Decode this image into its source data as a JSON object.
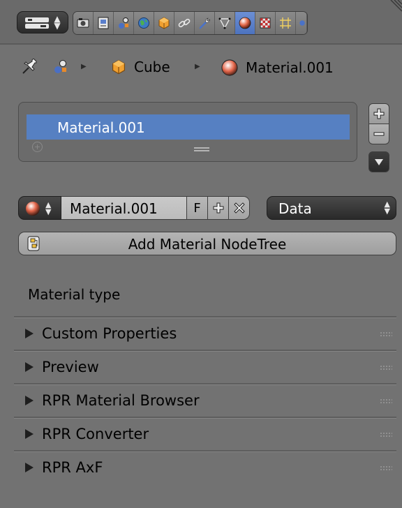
{
  "tabs": [
    {
      "icon": "render-camera-icon",
      "active": false
    },
    {
      "icon": "render-layers-icon",
      "active": false
    },
    {
      "icon": "scene-icon",
      "active": false
    },
    {
      "icon": "world-icon",
      "active": false
    },
    {
      "icon": "object-icon",
      "active": false
    },
    {
      "icon": "constraints-icon",
      "active": false
    },
    {
      "icon": "modifiers-wrench-icon",
      "active": false
    },
    {
      "icon": "object-data-mesh-icon",
      "active": false
    },
    {
      "icon": "material-icon",
      "active": true
    },
    {
      "icon": "texture-icon",
      "active": false
    },
    {
      "icon": "particles-icon",
      "active": false
    },
    {
      "icon": "physics-icon",
      "active": false
    }
  ],
  "breadcrumb": {
    "object": "Cube",
    "material": "Material.001"
  },
  "slots": {
    "items": [
      "Material.001"
    ],
    "selected": 0
  },
  "material_row": {
    "name": "Material.001",
    "fake_user": "F",
    "link_dropdown": "Data"
  },
  "nodetree_button": "Add Material NodeTree",
  "material_type_label": "Material type",
  "panels": [
    "Custom Properties",
    "Preview",
    "RPR Material Browser",
    "RPR Converter",
    "RPR AxF"
  ],
  "colors": {
    "background": "#727272",
    "selection": "#5680c2",
    "active_tab": "#5a80c8"
  }
}
